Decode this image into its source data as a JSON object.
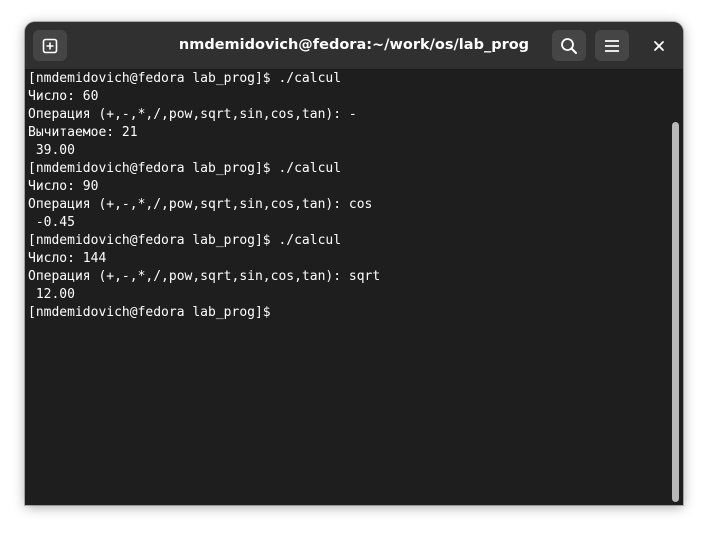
{
  "window": {
    "title": "nmdemidovich@fedora:~/work/os/lab_prog",
    "icons": {
      "new_tab": "new-tab-icon",
      "search": "search-icon",
      "menu": "hamburger-menu-icon",
      "close": "close-icon"
    },
    "close_glyph": "×"
  },
  "terminal": {
    "colors": {
      "background": "#1e1e1e",
      "foreground": "#ffffff",
      "titlebar": "#303030"
    },
    "lines": [
      "[nmdemidovich@fedora lab_prog]$ ./calcul",
      "Число: 60",
      "Операция (+,-,*,/,pow,sqrt,sin,cos,tan): -",
      "Вычитаемое: 21",
      " 39.00",
      "[nmdemidovich@fedora lab_prog]$ ./calcul",
      "Число: 90",
      "Операция (+,-,*,/,pow,sqrt,sin,cos,tan): cos",
      " -0.45",
      "[nmdemidovich@fedora lab_prog]$ ./calcul",
      "Число: 144",
      "Операция (+,-,*,/,pow,sqrt,sin,cos,tan): sqrt",
      " 12.00",
      "[nmdemidovich@fedora lab_prog]$ "
    ]
  }
}
